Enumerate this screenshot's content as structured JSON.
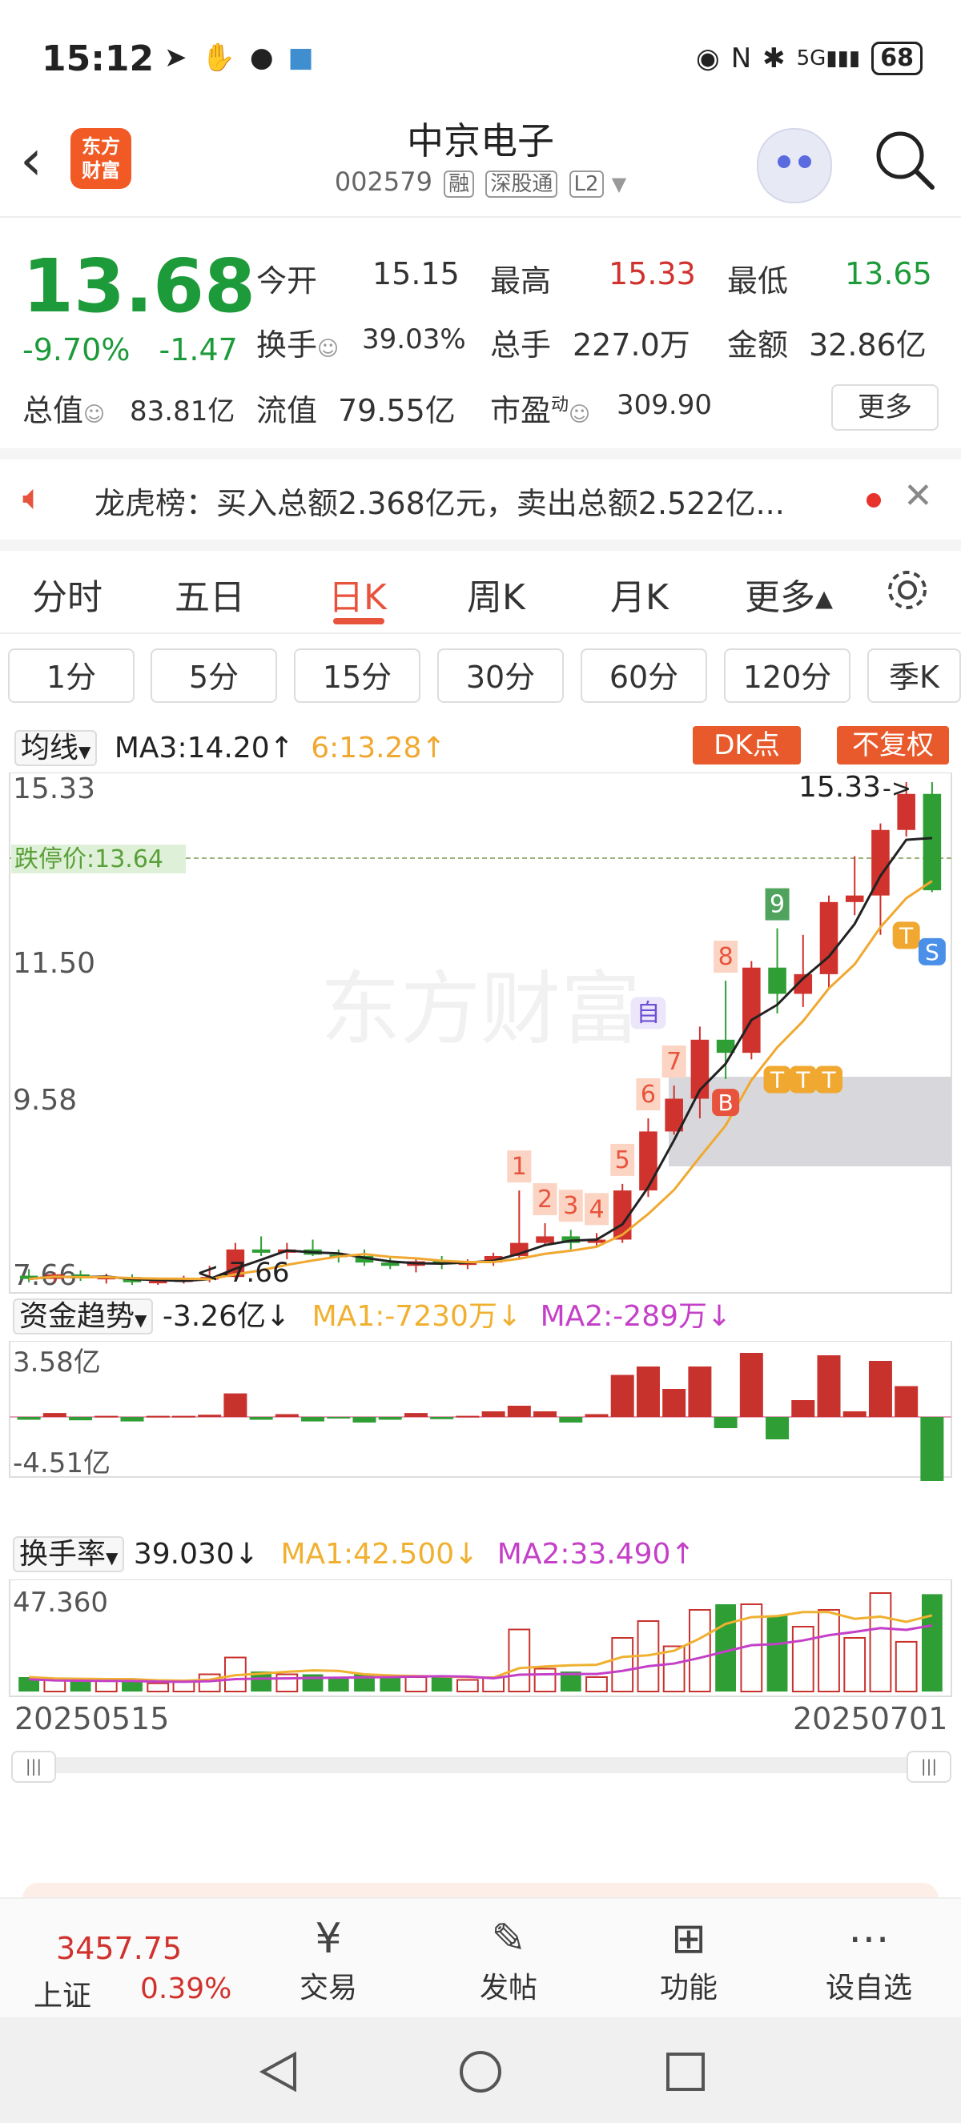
{
  "status_bar": {
    "time": "15:12",
    "battery": "68"
  },
  "header": {
    "logo_line1": "东方",
    "logo_line2": "财富",
    "name": "中京电子",
    "code": "002579",
    "tags": [
      "融",
      "深股通",
      "L2"
    ]
  },
  "quote": {
    "price": "13.68",
    "change_pct": "-9.70%",
    "change_amt": "-1.47",
    "open_label": "今开",
    "open": "15.15",
    "high_label": "最高",
    "high": "15.33",
    "low_label": "最低",
    "low": "13.65",
    "turnover_label": "换手",
    "turnover": "39.03%",
    "volume_label": "总手",
    "volume": "227.0万",
    "amount_label": "金额",
    "amount": "32.86亿",
    "mktcap_label": "总值",
    "mktcap": "83.81亿",
    "float_label": "流值",
    "float_cap": "79.55亿",
    "pe_label": "市盈",
    "pe_sup": "动",
    "pe": "309.90",
    "more_label": "更多"
  },
  "notice": {
    "text": "龙虎榜：买入总额2.368亿元，卖出总额2.522亿..."
  },
  "tabs": [
    "分时",
    "五日",
    "日K",
    "周K",
    "月K",
    "更多▴"
  ],
  "periods": [
    "1分",
    "5分",
    "15分",
    "30分",
    "60分",
    "120分",
    "季K"
  ],
  "kchart": {
    "indicator": "均线",
    "ma3": "MA3:14.20↑",
    "ma6": "6:13.28↑",
    "dk_label": "DK点",
    "fq_label": "不复权",
    "ticks": [
      "15.33",
      "11.50",
      "9.58",
      "7.66"
    ],
    "limit_price": "13.64",
    "limit_label": "跌停价",
    "high_marker": "15.33",
    "low_marker": "7.66",
    "seq_marks": [
      "1",
      "2",
      "3",
      "4",
      "5",
      "6",
      "7",
      "8",
      "9"
    ],
    "zi_mark": "自",
    "b_mark": "B",
    "t_mark": "T",
    "s_mark": "S",
    "watermark": "东方财富"
  },
  "fund": {
    "indicator": "资金趋势",
    "value": "-3.26亿↓",
    "ma1": "MA1:-7230万↓",
    "ma2": "MA2:-289万↓",
    "top": "3.58亿",
    "bottom": "-4.51亿"
  },
  "turn": {
    "indicator": "换手率",
    "value": "39.030↓",
    "ma1": "MA1:42.500↓",
    "ma2": "MA2:33.490↑",
    "top": "47.360"
  },
  "dates": {
    "start": "20250515",
    "end": "20250701"
  },
  "bottom_nav": {
    "index_value": "3457.75",
    "index_name": "上证",
    "index_change": "0.39%",
    "items": [
      "交易",
      "发帖",
      "功能",
      "设自选"
    ]
  },
  "chart_data": [
    {
      "type": "candlestick",
      "title": "",
      "ylim": [
        7.66,
        15.33
      ],
      "ohlc": [
        [
          7.8,
          7.9,
          7.7,
          7.75
        ],
        [
          7.75,
          7.85,
          7.7,
          7.82
        ],
        [
          7.82,
          7.88,
          7.72,
          7.76
        ],
        [
          7.76,
          7.83,
          7.68,
          7.78
        ],
        [
          7.78,
          7.82,
          7.66,
          7.7
        ],
        [
          7.7,
          7.75,
          7.66,
          7.72
        ],
        [
          7.72,
          7.8,
          7.68,
          7.74
        ],
        [
          7.74,
          7.95,
          7.7,
          7.78
        ],
        [
          7.78,
          8.3,
          7.75,
          8.2
        ],
        [
          8.2,
          8.4,
          8.1,
          8.15
        ],
        [
          8.15,
          8.3,
          8.05,
          8.2
        ],
        [
          8.2,
          8.35,
          8.1,
          8.12
        ],
        [
          8.12,
          8.2,
          8.0,
          8.1
        ],
        [
          8.1,
          8.2,
          7.95,
          8.0
        ],
        [
          8.0,
          8.1,
          7.9,
          7.95
        ],
        [
          7.95,
          8.05,
          7.85,
          8.02
        ],
        [
          8.02,
          8.1,
          7.9,
          7.98
        ],
        [
          7.98,
          8.05,
          7.9,
          8.0
        ],
        [
          8.0,
          8.15,
          7.95,
          8.1
        ],
        [
          8.1,
          9.1,
          8.05,
          8.3
        ],
        [
          8.3,
          8.6,
          8.25,
          8.4
        ],
        [
          8.4,
          8.5,
          8.2,
          8.3
        ],
        [
          8.3,
          8.45,
          8.25,
          8.35
        ],
        [
          8.35,
          9.2,
          8.3,
          9.1
        ],
        [
          9.1,
          10.2,
          9.0,
          10.0
        ],
        [
          10.0,
          10.7,
          9.95,
          10.5
        ],
        [
          10.5,
          11.6,
          10.2,
          11.4
        ],
        [
          11.4,
          12.3,
          10.8,
          11.2
        ],
        [
          11.2,
          12.6,
          11.1,
          12.5
        ],
        [
          12.5,
          13.1,
          11.8,
          12.1
        ],
        [
          12.1,
          13.0,
          11.9,
          12.4
        ],
        [
          12.4,
          13.6,
          12.2,
          13.5
        ],
        [
          13.5,
          14.2,
          13.3,
          13.6
        ],
        [
          13.6,
          14.7,
          13.0,
          14.6
        ],
        [
          14.6,
          15.33,
          14.5,
          15.15
        ],
        [
          15.15,
          15.33,
          13.65,
          13.68
        ]
      ]
    }
  ]
}
